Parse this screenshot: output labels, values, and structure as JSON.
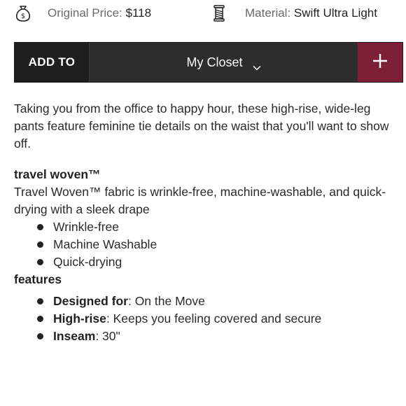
{
  "info": {
    "price_icon": "money-bag-icon",
    "price_label": "Original Price:",
    "price_value": "$118",
    "material_icon": "thread-spool-icon",
    "material_label": "Material:",
    "material_value": "Swift Ultra Light"
  },
  "add_bar": {
    "add_to_label": "ADD TO",
    "closet_value": "My Closet",
    "plus_icon": "plus-icon"
  },
  "description": "Taking you from the office to happy hour, these high-rise, wide-leg pants feature feminine tie details on the waist that you'll want to show off.",
  "fabric": {
    "heading": "travel woven™",
    "text": "Travel Woven™ fabric is wrinkle-free, machine-washable, and quick-drying with a sleek drape",
    "bullets": [
      "Wrinkle-free",
      "Machine Washable",
      "Quick-drying"
    ]
  },
  "features": {
    "heading": "features",
    "items": [
      {
        "label": "Designed for",
        "value": ": On the Move"
      },
      {
        "label": "High-rise",
        "value": ": Keeps you feeling covered and secure"
      },
      {
        "label": "Inseam",
        "value": ": 30\""
      }
    ]
  },
  "colors": {
    "bar_dark": "#2b2b2b",
    "add_to_bg": "#1e1e1e",
    "accent": "#7e1f38"
  }
}
